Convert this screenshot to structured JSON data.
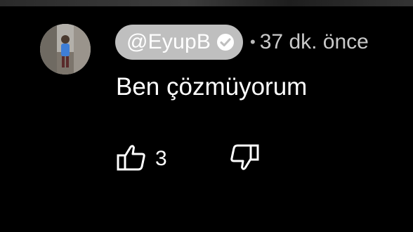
{
  "comment": {
    "author": "@EyupB",
    "verified": true,
    "separator": "•",
    "timestamp": "37 dk. önce",
    "text": "Ben çözmüyorum",
    "like_count": "3"
  },
  "icons": {
    "verified": "check-circle-icon",
    "like": "thumbs-up-icon",
    "dislike": "thumbs-down-icon"
  },
  "colors": {
    "background": "#000000",
    "author_chip": "#bfbfbf",
    "text": "#ffffff",
    "meta_text": "#c9c9c9"
  }
}
